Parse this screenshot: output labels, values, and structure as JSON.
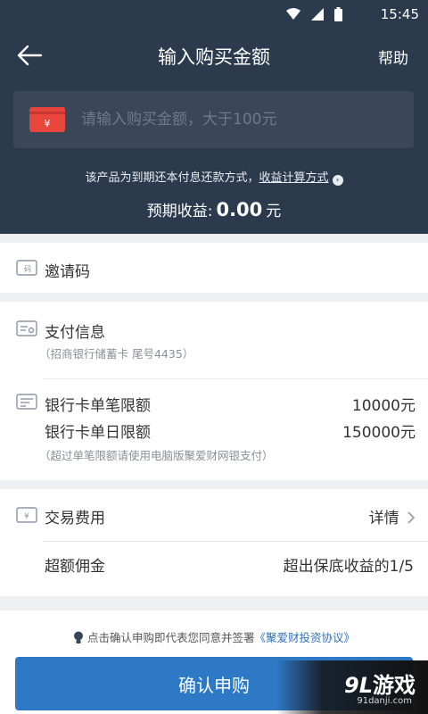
{
  "status_bar": {
    "time": "15:45"
  },
  "nav": {
    "title": "输入购买金额",
    "help": "帮助"
  },
  "amount": {
    "currency_symbol": "¥",
    "placeholder": "请输入购买金额，大于100元",
    "value": ""
  },
  "repay": {
    "text": "该产品为到期还本付息还款方式，",
    "link": "收益计算方式"
  },
  "expected": {
    "label": "预期收益:",
    "value": "0.00",
    "unit": "元"
  },
  "invite": {
    "label": "邀请码"
  },
  "payment": {
    "label": "支付信息",
    "card_info": "（招商银行储蓄卡 尾号4435）",
    "single_limit_label": "银行卡单笔限额",
    "single_limit_value": "10000元",
    "daily_limit_label": "银行卡单日限额",
    "daily_limit_value": "150000元",
    "limit_note": "（超过单笔限额请使用电脑版聚爱财网银支付）"
  },
  "fees": {
    "label": "交易费用",
    "detail": "详情",
    "commission_label": "超额佣金",
    "commission_value": "超出保底收益的1/5"
  },
  "agreement": {
    "text": "点击确认申购即代表您同意并签署",
    "link": "《聚爱财投资协议》"
  },
  "confirm": {
    "label": "确认申购"
  },
  "watermark": {
    "logo_num": "9L",
    "logo_text": "游戏",
    "site": "91danji.com"
  },
  "colors": {
    "header_bg": "#2c3a4e",
    "accent": "#2e79c6",
    "card_red": "#e8453c"
  }
}
